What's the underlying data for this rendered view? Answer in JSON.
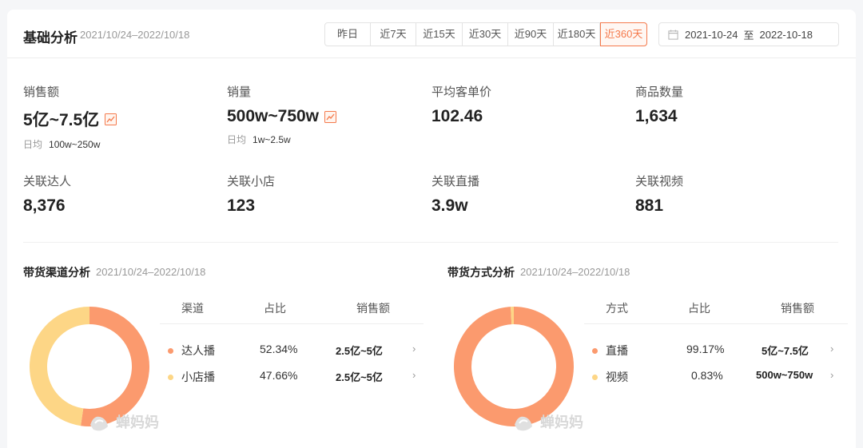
{
  "header": {
    "title": "基础分析",
    "date_range": "2021/10/24–2022/10/18",
    "ranges": [
      "昨日",
      "近7天",
      "近15天",
      "近30天",
      "近90天",
      "近180天",
      "近360天"
    ],
    "active_range": "近360天",
    "date_start": "2021-10-24",
    "date_sep": "至",
    "date_end": "2022-10-18"
  },
  "metrics": [
    {
      "label": "销售额",
      "value": "5亿~7.5亿",
      "trend": true,
      "sub_label": "日均",
      "sub_value": "100w~250w"
    },
    {
      "label": "销量",
      "value": "500w~750w",
      "trend": true,
      "sub_label": "日均",
      "sub_value": "1w~2.5w"
    },
    {
      "label": "平均客单价",
      "value": "102.46"
    },
    {
      "label": "商品数量",
      "value": "1,634"
    },
    {
      "label": "关联达人",
      "value": "8,376"
    },
    {
      "label": "关联小店",
      "value": "123"
    },
    {
      "label": "关联直播",
      "value": "3.9w"
    },
    {
      "label": "关联视频",
      "value": "881"
    }
  ],
  "channel": {
    "title": "带货渠道分析",
    "date": "2021/10/24–2022/10/18",
    "columns": [
      "渠道",
      "占比",
      "销售额"
    ],
    "rows": [
      {
        "name": "达人播",
        "share": "52.34%",
        "sales": "2.5亿~5亿",
        "share_value": 52.34,
        "color": "#fb9a6e"
      },
      {
        "name": "小店播",
        "share": "47.66%",
        "sales": "2.5亿~5亿",
        "share_value": 47.66,
        "color": "#fdd686"
      }
    ]
  },
  "method": {
    "title": "带货方式分析",
    "date": "2021/10/24–2022/10/18",
    "columns": [
      "方式",
      "占比",
      "销售额"
    ],
    "rows": [
      {
        "name": "直播",
        "share": "99.17%",
        "sales": "5亿~7.5亿",
        "share_value": 99.17,
        "color": "#fb9a6e"
      },
      {
        "name": "视频",
        "share": "0.83%",
        "sales": "500w~750w",
        "share_value": 0.83,
        "color": "#fdd686"
      }
    ]
  },
  "watermark": "蝉妈妈",
  "colors": {
    "accent": "#f57a4c",
    "orange": "#fb9a6e",
    "yellow": "#fdd686"
  }
}
